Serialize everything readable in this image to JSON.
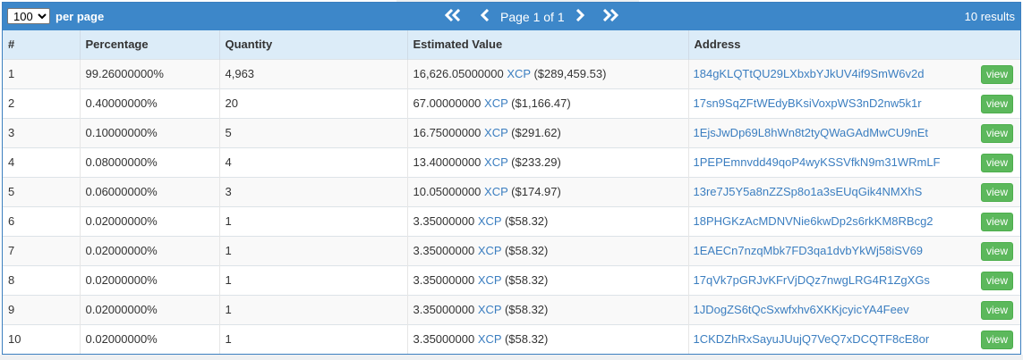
{
  "pager": {
    "per_page_value": "100",
    "per_page_label": "per page",
    "first_icon": "double-chevron-left",
    "prev_icon": "chevron-left",
    "page_text": "Page 1 of 1",
    "next_icon": "chevron-right",
    "last_icon": "double-chevron-right",
    "results_text": "10 results"
  },
  "table": {
    "headers": [
      "#",
      "Percentage",
      "Quantity",
      "Estimated Value",
      "Address"
    ],
    "view_label": "view",
    "rows": [
      {
        "num": "1",
        "pct": "99.26000000%",
        "qty": "4,963",
        "val": "16,626.05000000",
        "asset": "XCP",
        "usd": "($289,459.53)",
        "addr": "184gKLQTtQU29LXbxbYJkUV4if9SmW6v2d"
      },
      {
        "num": "2",
        "pct": "0.40000000%",
        "qty": "20",
        "val": "67.00000000",
        "asset": "XCP",
        "usd": "($1,166.47)",
        "addr": "17sn9SqZFtWEdyBKsiVoxpWS3nD2nw5k1r"
      },
      {
        "num": "3",
        "pct": "0.10000000%",
        "qty": "5",
        "val": "16.75000000",
        "asset": "XCP",
        "usd": "($291.62)",
        "addr": "1EjsJwDp69L8hWn8t2tyQWaGAdMwCU9nEt"
      },
      {
        "num": "4",
        "pct": "0.08000000%",
        "qty": "4",
        "val": "13.40000000",
        "asset": "XCP",
        "usd": "($233.29)",
        "addr": "1PEPEmnvdd49qoP4wyKSSVfkN9m31WRmLF"
      },
      {
        "num": "5",
        "pct": "0.06000000%",
        "qty": "3",
        "val": "10.05000000",
        "asset": "XCP",
        "usd": "($174.97)",
        "addr": "13re7J5Y5a8nZZSp8o1a3sEUqGik4NMXhS"
      },
      {
        "num": "6",
        "pct": "0.02000000%",
        "qty": "1",
        "val": "3.35000000",
        "asset": "XCP",
        "usd": "($58.32)",
        "addr": "18PHGKzAcMDNVNie6kwDp2s6rkKM8RBcg2"
      },
      {
        "num": "7",
        "pct": "0.02000000%",
        "qty": "1",
        "val": "3.35000000",
        "asset": "XCP",
        "usd": "($58.32)",
        "addr": "1EAECn7nzqMbk7FD3qa1dvbYkWj58iSV69"
      },
      {
        "num": "8",
        "pct": "0.02000000%",
        "qty": "1",
        "val": "3.35000000",
        "asset": "XCP",
        "usd": "($58.32)",
        "addr": "17qVk7pGRJvKFrVjDQz7nwgLRG4R1ZgXGs"
      },
      {
        "num": "9",
        "pct": "0.02000000%",
        "qty": "1",
        "val": "3.35000000",
        "asset": "XCP",
        "usd": "($58.32)",
        "addr": "1JDogZS6tQcSxwfxhv6XKKjcyicYA4Feev"
      },
      {
        "num": "10",
        "pct": "0.02000000%",
        "qty": "1",
        "val": "3.35000000",
        "asset": "XCP",
        "usd": "($58.32)",
        "addr": "1CKDZhRxSayuJUujQ7VeQ7xDCQTF8cE8or"
      }
    ]
  },
  "colors": {
    "header_bar": "#3d87c9",
    "table_header": "#dcecf8",
    "link": "#3b7ec0",
    "view_button": "#5cb85c"
  }
}
